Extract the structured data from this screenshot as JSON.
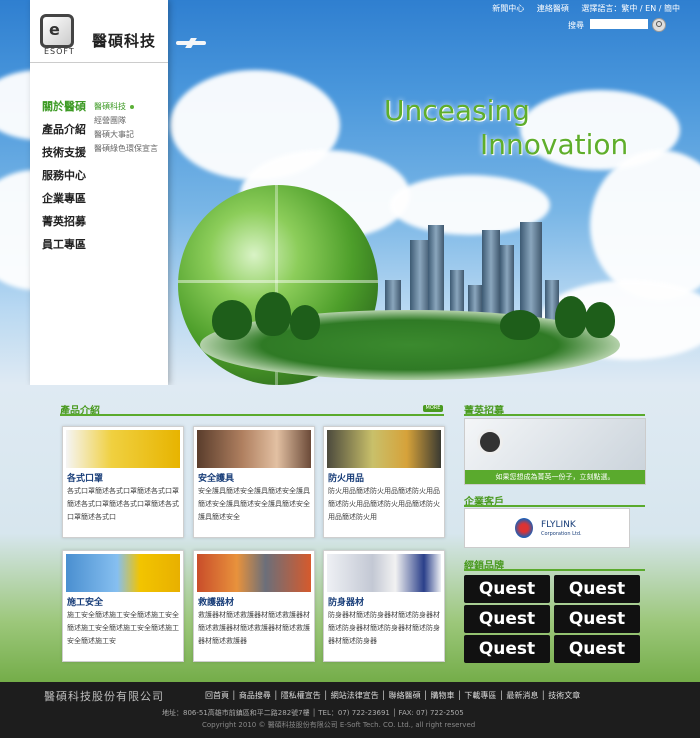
{
  "top_links": [
    "新聞中心",
    "連絡醫碩",
    "選擇語言：繁中 / EN / 簡中"
  ],
  "search": {
    "label": "搜尋",
    "placeholder": ""
  },
  "brand": {
    "logo_letter": "e",
    "logo_sub": "ESOFT",
    "name": "醫碩科技"
  },
  "hero": {
    "line1": "Unceasing",
    "line2": "Innovation"
  },
  "nav": {
    "items": [
      "關於醫碩",
      "產品介紹",
      "技術支援",
      "服務中心",
      "企業專區",
      "菁英招募",
      "員工專區"
    ],
    "subitems": [
      "醫碩科技",
      "經營團隊",
      "醫碩大事記",
      "醫碩綠色環保宣言"
    ]
  },
  "products": {
    "title": "產品介紹",
    "more": "MORE",
    "cards": [
      {
        "title": "各式口罩",
        "desc": "各式口罩簡述各式口罩簡述各式口罩簡述各式口罩簡述各式口罩簡述各式口罩簡述各式口"
      },
      {
        "title": "安全護具",
        "desc": "安全護具簡述安全護具簡述安全護具簡述安全護具簡述安全護具簡述安全護具簡述安全"
      },
      {
        "title": "防火用品",
        "desc": "防火用品簡述防火用品簡述防火用品簡述防火用品簡述防火用品簡述防火用品簡述防火用"
      },
      {
        "title": "施工安全",
        "desc": "施工安全簡述施工安全簡述施工安全簡述施工安全簡述施工安全簡述施工安全簡述施工安"
      },
      {
        "title": "救護器材",
        "desc": "救護器材簡述救護器材簡述救護器材簡述救護器材簡述救護器材簡述救護器材簡述救護器"
      },
      {
        "title": "防身器材",
        "desc": "防身器材簡述防身器材簡述防身器材簡述防身器材簡述防身器材簡述防身器材簡述防身器"
      }
    ]
  },
  "recruit": {
    "title": "菁英招募",
    "banner": "如果您想成為菁英一份子，立刻點選。"
  },
  "clients": {
    "title": "企業客戶",
    "name": "FLYLINK",
    "sub": "Corporation Ltd."
  },
  "brands": {
    "title": "經銷品牌",
    "logo": "Quest"
  },
  "footer": {
    "company": "醫碩科技股份有限公司",
    "links": "回首頁 │ 商品搜尋 │ 隱私權宣告 │ 網站法律宣告 │ 聯絡醫碩 │ 購物車 │ 下載專區 │ 最新消息 │ 技術文章",
    "address": "地址：806-51高雄市前鎮區和平二路282號7樓 │ TEL：07) 722-23691 │ FAX: 07) 722-2505",
    "copyright": "Copyright 2010 © 醫碩科技股份有限公司 E-Soft Tech. CO. Ltd., all right reserved"
  }
}
